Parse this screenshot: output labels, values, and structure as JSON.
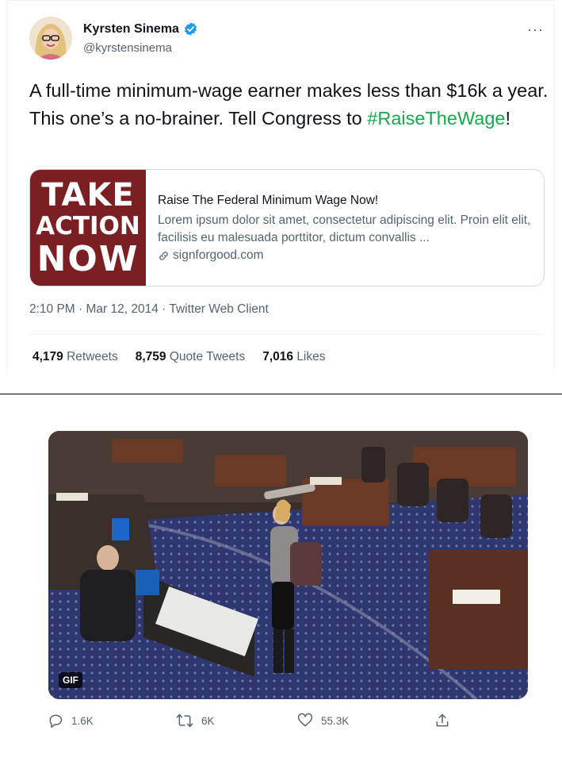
{
  "user": {
    "name": "Kyrsten Sinema",
    "handle": "@kyrstensinema",
    "verified_icon": "verified-badge-icon",
    "more_label": "···"
  },
  "tweet": {
    "text_part1": "A full-time minimum-wage earner makes less than $16k a year. This one’s a no-brainer. Tell Congress to ",
    "hashtag": "#RaiseTheWage",
    "text_part2": "!",
    "hashtag_color": "#17a84b"
  },
  "card": {
    "image_line1": "TAKE",
    "image_line2": "ACTION",
    "image_line3": "NOW",
    "image_bg_color": "#7b1f22",
    "title": "Raise The Federal Minimum Wage Now!",
    "description": "Lorem ipsum dolor sit amet, consectetur adipiscing elit. Proin elit elit, facilisis eu malesuada porttitor, dictum convallis ...",
    "link": "signforgood.com",
    "link_icon": "link-icon"
  },
  "meta": {
    "timestamp": "2:10 PM · Mar 12, 2014 · Twitter Web Client"
  },
  "stats": {
    "retweets_count": "4,179",
    "retweets_label": "Retweets",
    "quotes_count": "8,759",
    "quotes_label": "Quote Tweets",
    "likes_count": "7,016",
    "likes_label": "Likes"
  },
  "media": {
    "badge": "GIF"
  },
  "actions": {
    "reply_count": "1.6K",
    "retweet_count": "6K",
    "like_count": "55.3K"
  }
}
